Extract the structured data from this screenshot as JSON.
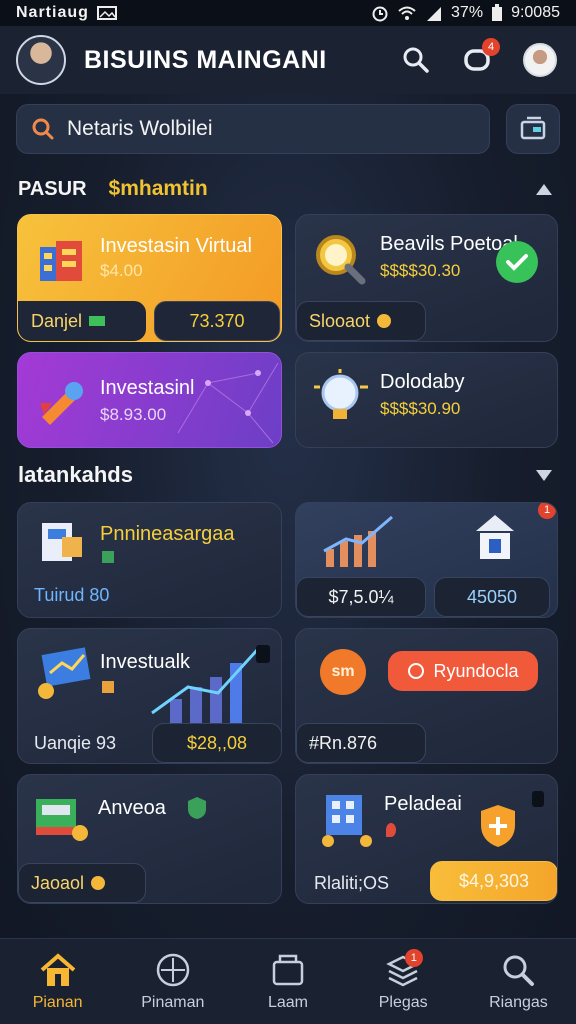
{
  "status_bar": {
    "left_text": "Nartiaug",
    "battery": "37%",
    "time": "9:0085"
  },
  "header": {
    "title": "BISUINS MAINGANI",
    "notification_count": "4"
  },
  "search": {
    "placeholder": "Netaris Wolbilei"
  },
  "section1": {
    "label": "PASUR",
    "highlight": "$mhamtin"
  },
  "cards_top": [
    {
      "title": "Investasin Virtual",
      "value": "$4.00",
      "pill_left": "Danjel",
      "pill_right": "73.370"
    },
    {
      "title": "Beavils Poetoal",
      "value": "$$$$30.30",
      "pill": "Slooaot"
    },
    {
      "title": "Investasinl",
      "value": "$8.93.00"
    },
    {
      "title": "Dolodaby",
      "value": "$$$$30.90"
    }
  ],
  "section2": {
    "label": "latankahds"
  },
  "cards_mid": [
    {
      "title": "Pnnineasargaa",
      "pill": "Tuirud 80"
    },
    {
      "pill_left": "$7,5.0¼",
      "pill_right": "45050",
      "badge": "1"
    },
    {
      "title": "Investualk",
      "pill_left": "Uanqie 93",
      "pill_right": "$28,,08"
    },
    {
      "coin": "sm",
      "button": "Ryundocla",
      "pill": "#Rn.876"
    },
    {
      "title": "Anveoa",
      "pill": "Jaoaol"
    },
    {
      "title": "Peladeai",
      "pill_left": "Rlaliti;OS",
      "pill_right": "$4,9,303"
    }
  ],
  "bottom_nav": [
    {
      "label": "Pianan",
      "icon": "home-icon",
      "active": true
    },
    {
      "label": "Pinaman",
      "icon": "compass-icon"
    },
    {
      "label": "Laam",
      "icon": "store-icon"
    },
    {
      "label": "Plegas",
      "icon": "stack-icon",
      "badge": "1"
    },
    {
      "label": "Riangas",
      "icon": "search-icon"
    }
  ],
  "colors": {
    "accent": "#f7b733",
    "gold": "#f6cf3b",
    "badge": "#e2432c",
    "bg": "#161d2c"
  }
}
